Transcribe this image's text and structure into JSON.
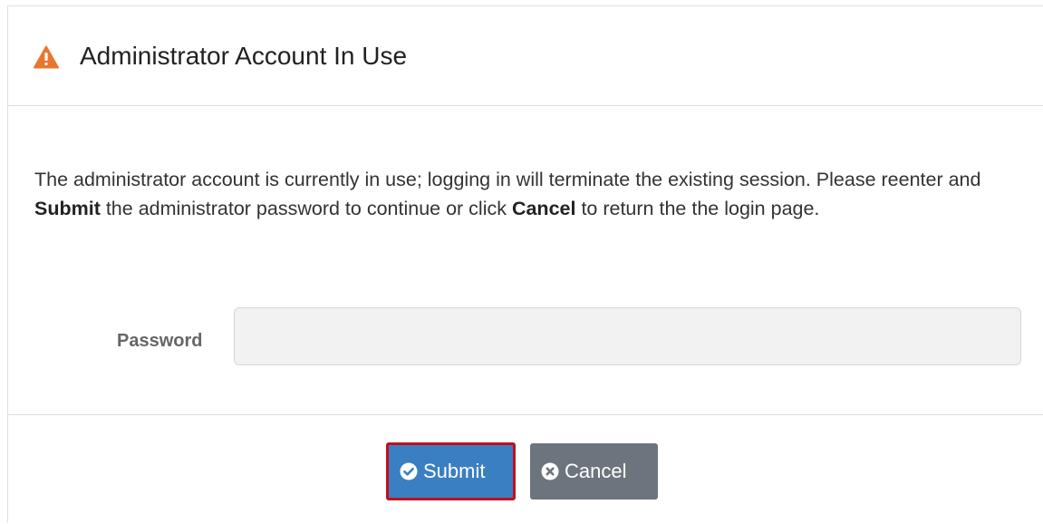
{
  "header": {
    "title": "Administrator Account In Use",
    "icon": "warning-triangle-icon",
    "icon_color": "#e8772e"
  },
  "message": {
    "part1": "The administrator account is currently in use; logging in will terminate the existing session. Please reenter and ",
    "bold1": "Submit",
    "part2": " the administrator password to continue or click ",
    "bold2": "Cancel",
    "part3": " to return the the login page."
  },
  "form": {
    "password_label": "Password",
    "password_value": "",
    "password_placeholder": ""
  },
  "buttons": {
    "submit_label": "Submit",
    "submit_icon": "check-circle-icon",
    "submit_color": "#3a7fc1",
    "cancel_label": "Cancel",
    "cancel_icon": "x-circle-icon",
    "cancel_color": "#6c757d",
    "focus_outline_color": "#c0101e"
  }
}
